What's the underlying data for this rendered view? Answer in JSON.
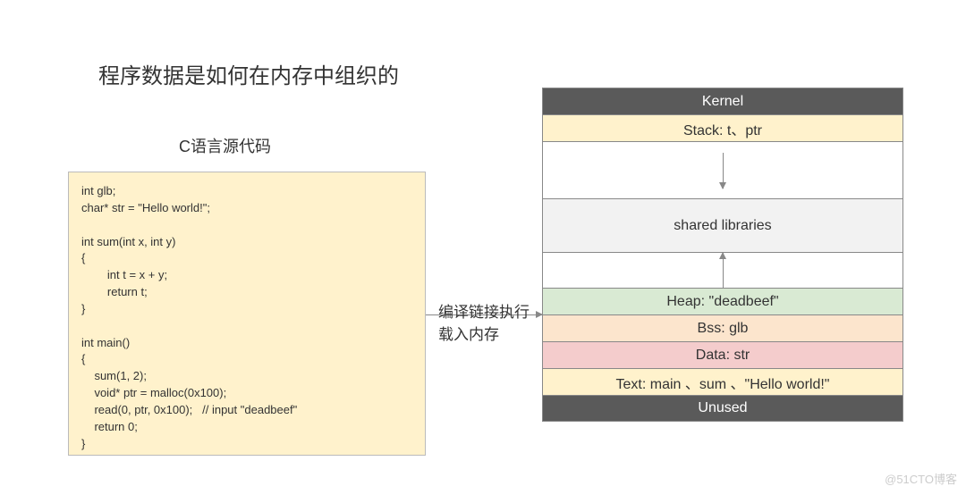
{
  "title": "程序数据是如何在内存中组织的",
  "subtitle": "C语言源代码",
  "code": "int glb;\nchar* str = \"Hello world!\";\n\nint sum(int x, int y)\n{\n        int t = x + y;\n        return t;\n}\n\nint main()\n{\n    sum(1, 2);\n    void* ptr = malloc(0x100);\n    read(0, ptr, 0x100);   // input \"deadbeef\"\n    return 0;\n}",
  "mid": {
    "line1": "编译链接执行",
    "line2": "载入内存"
  },
  "mem": {
    "kernel": "Kernel",
    "stack": "Stack: t、ptr",
    "shared": "shared libraries",
    "heap": "Heap: \"deadbeef\"",
    "bss": "Bss: glb",
    "data": "Data: str",
    "text": "Text: main 、sum 、\"Hello world!\"",
    "unused": "Unused"
  },
  "watermark": "@51CTO博客"
}
